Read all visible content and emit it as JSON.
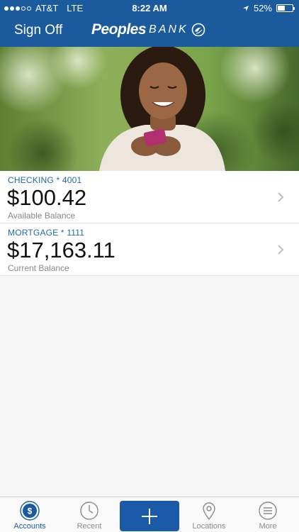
{
  "status_bar": {
    "carrier": "AT&T",
    "network": "LTE",
    "time": "8:22 AM",
    "battery": "52%",
    "battery_level": 0.52
  },
  "nav": {
    "sign_off": "Sign Off",
    "logo_word1": "Peoples",
    "logo_word2": "BANK"
  },
  "accounts": [
    {
      "name": "CHECKING * 4001",
      "amount": "$100.42",
      "sub": "Available Balance"
    },
    {
      "name": "MORTGAGE * 1111",
      "amount": "$17,163.11",
      "sub": "Current Balance"
    }
  ],
  "tabs": [
    {
      "label": "Accounts",
      "icon": "dollar-circle-icon",
      "active": true
    },
    {
      "label": "Recent",
      "icon": "clock-icon"
    },
    {
      "label": "",
      "icon": "plus-icon"
    },
    {
      "label": "Locations",
      "icon": "map-pin-icon"
    },
    {
      "label": "More",
      "icon": "menu-icon"
    }
  ],
  "colors": {
    "brand_blue": "#1b5a9c",
    "account_name": "#1f6aa8",
    "background": "#f7f7f7"
  }
}
